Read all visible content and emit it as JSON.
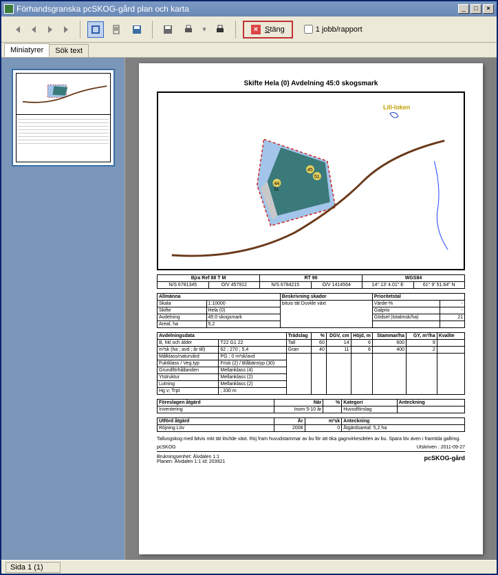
{
  "window": {
    "title": "Förhandsgranska pcSKOG-gård plan och karta"
  },
  "toolbar": {
    "close_label": "Stäng",
    "checkbox_label": "1 jobb/rapport"
  },
  "tabs": {
    "thumbnails": "Miniatyrer",
    "search": "Sök text"
  },
  "page": {
    "title": "Skifte Hela (0)  Avdelning 45:0 skogsmark",
    "map_label": "Lill-loken",
    "map_numbers": [
      "44",
      "45"
    ],
    "coord_headers": [
      "Bjra Ref 88 T M",
      "RT 90",
      "WGS84"
    ],
    "coord_row": [
      "N/S 6781345",
      "Ö/V 457912",
      "N/S 6784215",
      "Ö/V 1414564",
      "14° 13' 4.01\" E",
      "61° 9' 51.64\" N"
    ],
    "general": {
      "header": "Allmänna",
      "header2": "Beskrivning skador",
      "header3": "Prioritetstal",
      "rows": [
        [
          "Skala",
          "1:10000",
          "bituis tät Duvkle växt",
          "Värde-%",
          "-"
        ],
        [
          "Skifte",
          "Hela (0)",
          "",
          "Galprio",
          "-"
        ],
        [
          "Avdelning",
          "45:0 skogsmark",
          "",
          "Gödsel (totalmsk/ha)",
          "21"
        ],
        [
          "Areal, ha",
          "5,2",
          "",
          "",
          ""
        ]
      ]
    },
    "avd": {
      "header": "Avdelningsdata",
      "cols": [
        "Trädslag",
        "%",
        "DGV, cm",
        "Höjd, m",
        "Stammar/ha",
        "GY, m³/ha",
        "Kvalite"
      ],
      "labels": [
        [
          "B, hkl och ålder",
          "T22  G1  22"
        ],
        [
          "m³sk (ha ; avd ; år till)",
          "62 ; 270 ; 5,4"
        ],
        [
          "Målklass/naturvård",
          "PG ; 0 m³sk/avd"
        ],
        [
          "Fuktklass / Veg.typ",
          "Frisk (2) / Blåbärstyp (30)"
        ],
        [
          "Grundförhållanden",
          "Mellanklass (4)"
        ],
        [
          "Ytstruktur",
          "Mellanklass (2)"
        ],
        [
          "Lutning",
          "Mellanklass (2)"
        ],
        [
          "Hg v; Trpt",
          "; 330 m"
        ]
      ],
      "species": [
        {
          "name": "Tall",
          "pct": 60,
          "dgv": 14,
          "hojd": 6,
          "stam": 600,
          "gy": 9,
          "kval": ""
        },
        {
          "name": "Gran",
          "pct": 40,
          "dgv": 11,
          "hojd": 6,
          "stam": 400,
          "gy": 2,
          "kval": ""
        }
      ]
    },
    "foreslaget": {
      "header": [
        "Föreslagen åtgärd",
        "När",
        "%",
        "Kategori",
        "Anteckning"
      ],
      "row": [
        "Inventering",
        "Inom 5-10 år",
        "",
        "Huvudförslag",
        ""
      ]
    },
    "utfort": {
      "header": [
        "Utförd åtgärd",
        "År",
        "m³sk",
        "Anteckning"
      ],
      "row": [
        "Röjning Löv",
        "2008",
        "0",
        "Åtgärdsareal: 5,2 ha"
      ]
    },
    "note": "Tallungskog med bitvis mkt tät löv/tde växt. Röj fram huvudstammar av bu för att öka gagnvirkesdelen av bu. Spara löv även i framtida gallring.",
    "footer": {
      "app": "pcSKOG",
      "printed": "Utskriven : 2011-09-27",
      "brukning": "Brukningsenhet: Älvdalen 1:1",
      "plan": "Planen: Älvdalen 1:1    Id: 203921",
      "brand": "pcSKOG-gård"
    }
  },
  "statusbar": {
    "page": "Sida 1 (1)"
  }
}
